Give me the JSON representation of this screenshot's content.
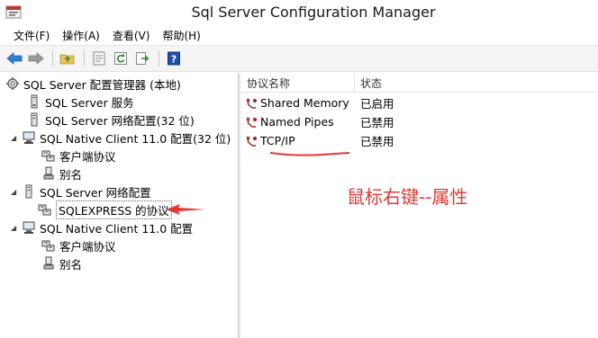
{
  "window": {
    "title": "Sql Server Configuration Manager"
  },
  "menu": {
    "file": "文件(F)",
    "action": "操作(A)",
    "view": "查看(V)",
    "help": "帮助(H)"
  },
  "tree": {
    "root": "SQL Server 配置管理器 (本地)",
    "services": "SQL Server 服务",
    "net32": "SQL Server 网络配置(32 位)",
    "native32": "SQL Native Client 11.0 配置(32 位)",
    "native32_client": "客户端协议",
    "native32_alias": "别名",
    "net": "SQL Server 网络配置",
    "sqlexpress": "SQLEXPRESS 的协议",
    "native": "SQL Native Client 11.0 配置",
    "native_client": "客户端协议",
    "native_alias": "别名"
  },
  "list": {
    "columns": {
      "name": "协议名称",
      "status": "状态"
    },
    "rows": [
      {
        "name": "Shared Memory",
        "status": "已启用"
      },
      {
        "name": "Named Pipes",
        "status": "已禁用"
      },
      {
        "name": "TCP/IP",
        "status": "已禁用"
      }
    ]
  },
  "annotation": {
    "text": "鼠标右键--属性",
    "color": "#e53935"
  },
  "icons": {
    "back": "arrow-left-icon",
    "forward": "arrow-right-icon",
    "up": "folder-up-icon",
    "properties": "properties-icon",
    "refresh": "refresh-icon",
    "export": "export-icon",
    "help": "help-icon"
  }
}
